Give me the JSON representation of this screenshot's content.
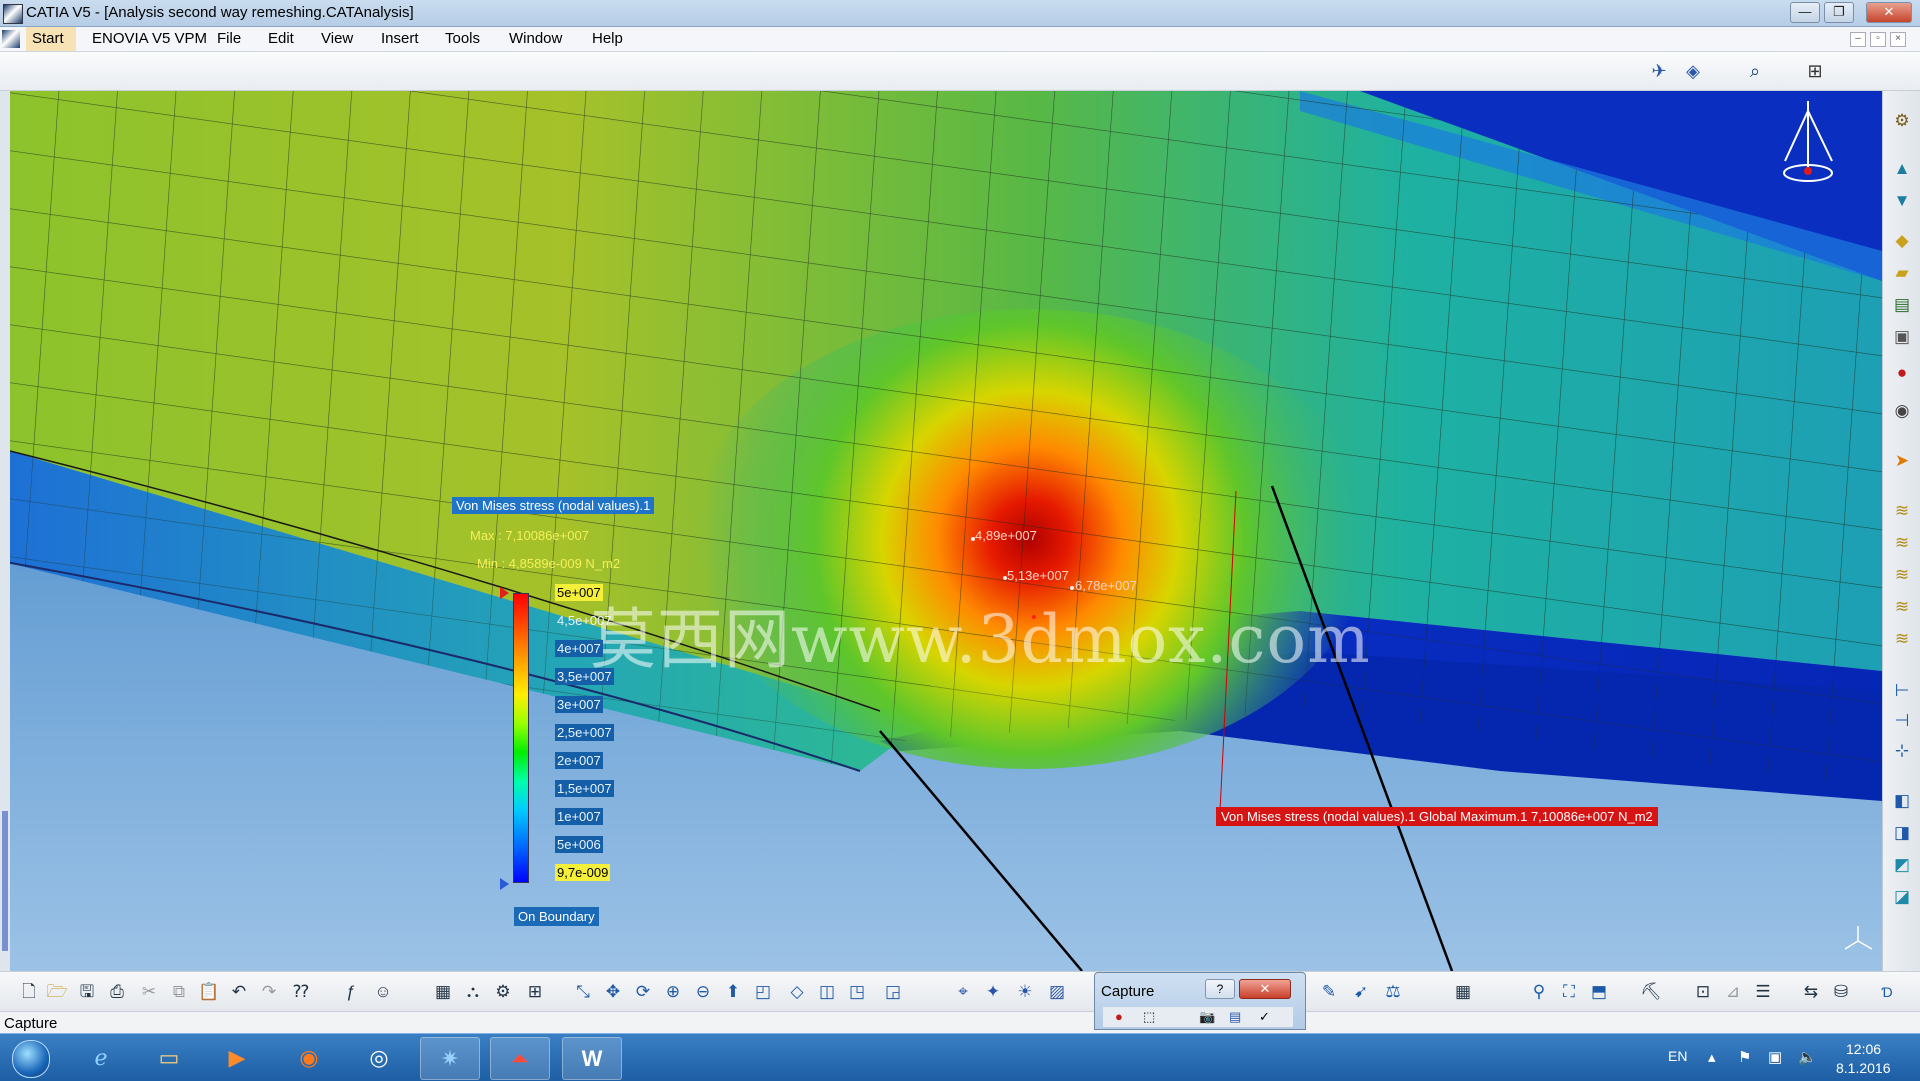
{
  "window": {
    "title": "CATIA V5 - [Analysis second way remeshing.CATAnalysis]",
    "buttons": {
      "minimize": "—",
      "restore": "❐",
      "close": "✕"
    }
  },
  "menu": {
    "items": [
      "Start",
      "ENOVIA V5 VPM",
      "File",
      "Edit",
      "View",
      "Insert",
      "Tools",
      "Window",
      "Help"
    ]
  },
  "legend": {
    "title": "Von Mises stress (nodal values).1",
    "max": "Max : 7,10086e+007",
    "min": "Min : 4,8589e-009 N_m2",
    "labels": [
      "5e+007",
      "4,5e+007",
      "4e+007",
      "3,5e+007",
      "3e+007",
      "2,5e+007",
      "2e+007",
      "1,5e+007",
      "1e+007",
      "5e+006",
      "9,7e-009"
    ],
    "boundary": "On Boundary"
  },
  "probes": [
    "4,89e+007",
    "5,13e+007",
    "6,78e+007"
  ],
  "global_max_label": "Von Mises stress (nodal values).1  Global Maximum.1  7,10086e+007 N_m2",
  "watermark": "莫西网www.3dmox.com",
  "status": {
    "text": "Capture"
  },
  "capture_dialog": {
    "title": "Capture",
    "help": "?",
    "close": "✕"
  },
  "taskbar": {
    "apps": [
      "internet-explorer",
      "file-explorer",
      "media-player",
      "firefox",
      "chrome",
      "catia",
      "acrobat",
      "word"
    ],
    "language": "EN",
    "time": "12:06",
    "date": "8.1.2016"
  },
  "colors": {
    "max_red": "#ff0000",
    "min_blue": "#0000ff",
    "legend_bg": "#1f74c9"
  }
}
